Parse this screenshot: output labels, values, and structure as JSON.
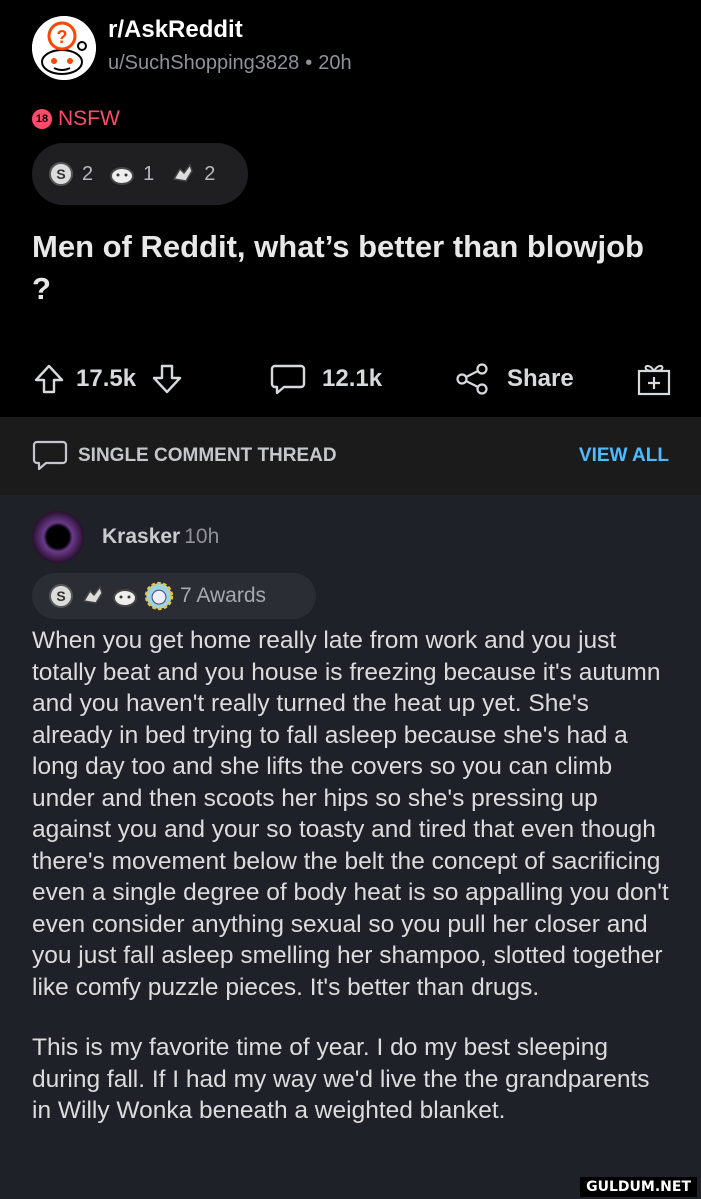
{
  "post": {
    "subreddit": "r/AskReddit",
    "author": "u/SuchShopping3828",
    "separator": "•",
    "age": "20h",
    "nsfw_badge": "18",
    "nsfw_label": "NSFW",
    "awards": [
      {
        "icon": "silver-award-icon",
        "count": "2"
      },
      {
        "icon": "wholesome-award-icon",
        "count": "1"
      },
      {
        "icon": "helpful-award-icon",
        "count": "2"
      }
    ],
    "title": "Men of Reddit, what’s better than blowjob ?",
    "upvotes": "17.5k",
    "comments": "12.1k",
    "share_label": "Share"
  },
  "thread": {
    "label": "SINGLE COMMENT THREAD",
    "view_all": "VIEW ALL"
  },
  "comment": {
    "author": "Krasker",
    "age": "10h",
    "awards_label": "7 Awards",
    "award_icons": [
      "silver-award-icon",
      "helpful-award-icon",
      "wholesome-award-icon",
      "starry-award-icon"
    ],
    "paragraphs": [
      "When you get home really late from work and you just totally beat and you house is freezing because it's autumn and you haven't really turned the heat up yet. She's already in bed trying to fall asleep because she's had a long day too and she lifts the covers so you can climb under and then scoots her hips so she's pressing up against you and your so toasty and tired that even though there's movement below the belt the concept of sacrificing even a single degree of body heat is so appalling you don't even consider anything sexual  so you pull her closer and you just fall asleep smelling her shampoo, slotted together like comfy puzzle pieces. It's better than drugs.",
      "This is my favorite time of year. I do my best sleeping during fall. If I had my way we'd live the the grandparents in Willy Wonka beneath a weighted blanket."
    ]
  },
  "watermark": "GULDUM.NET"
}
